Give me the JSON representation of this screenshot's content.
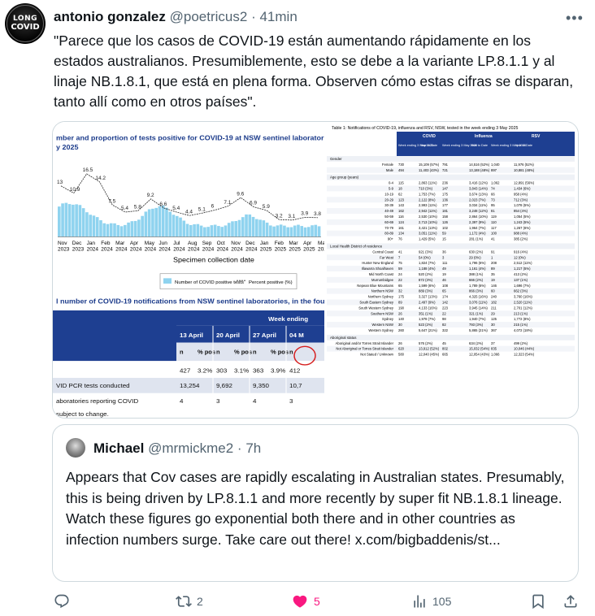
{
  "post": {
    "author_name": "antonio gonzalez",
    "author_handle": "@poetricus2",
    "separator": "·",
    "time": "41min",
    "avatar_text_1": "LONG",
    "avatar_text_2": "COVID",
    "text": "\"Parece que los casos de COVID-19 están aumentando rápidamente en los estados australianos. Presumiblemente, esto se debe a la variante LP.8.1.1 y al linaje NB.1.8.1, que está en plena forma. Observen cómo estas cifras se disparan, tanto allí como en otros países\"."
  },
  "media": {
    "left": {
      "chart_title": "mber and proportion of tests positive for COVID-19 at NSW sentinel laboratories by week,",
      "chart_title_2": "y 2025",
      "x_axis_label": "Specimen collection date",
      "legend_bar": "Number of COVID positive tests",
      "legend_line": "Percent positive (%)",
      "x_ticks_month": [
        "Nov",
        "Dec",
        "Jan",
        "Feb",
        "Mar",
        "Apr",
        "May",
        "Jun",
        "Jul",
        "Aug",
        "Sep",
        "Oct",
        "Nov",
        "Dec",
        "Jan",
        "Feb",
        "Mar",
        "Apr",
        "May"
      ],
      "x_ticks_year": [
        "2023",
        "2023",
        "2024",
        "2024",
        "2024",
        "2024",
        "2024",
        "2024",
        "2024",
        "2024",
        "2024",
        "2024",
        "2024",
        "2024",
        "2025",
        "2025",
        "2025",
        "2025",
        "2025"
      ],
      "pct_labels": [
        "13",
        "10.9",
        "16.5",
        "14.2",
        "7.5",
        "5.4",
        "5.8",
        "9.2",
        "6.6",
        "5.4",
        "4.4",
        "5.1",
        "6",
        "7.1",
        "9.6",
        "6.9",
        "5.9",
        "3.2",
        "3.1",
        "3.9",
        "3.8"
      ],
      "table_title": "l number of COVID-19 notifications from NSW sentinel laboratories, in the four weeks to 4 M",
      "week_ending": "Week ending",
      "weeks": [
        "13 April",
        "20 April",
        "27 April",
        "04 M"
      ],
      "sub_n": "n",
      "sub_pos": "% pos",
      "row1": [
        "427",
        "3.2%",
        "303",
        "3.1%",
        "363",
        "3.9%",
        "412"
      ],
      "row2_label": "VID PCR tests conducted",
      "row2": [
        "13,254",
        "9,692",
        "9,350",
        "10,7"
      ],
      "row3_label": "aboratories reporting COVID",
      "row3": [
        "4",
        "3",
        "4",
        "3"
      ],
      "footnote": "subject to change."
    },
    "right": {
      "title": "Table 1: Notifications of COVID-19, influenza and RSV, NSW, tested in the week ending 3 May 2025",
      "col_covid": "COVID",
      "col_flu": "Influenza",
      "col_rsv": "RSV",
      "sub_week": "Week ending 3 May 2025",
      "sub_ytd": "Year to Date",
      "sections": [
        {
          "heading": "Gender",
          "rows": [
            [
              "Female",
              "730",
              "15,109 (57%)",
              "791",
              "14,516 (52%)",
              "1,040",
              "11,976 (52%)"
            ],
            [
              "Male",
              "494",
              "11,403 (43%)",
              "721",
              "13,188 (48%)",
              "897",
              "10,881 (48%)"
            ]
          ]
        },
        {
          "heading": "Age group (years)",
          "rows": [
            [
              "0-4",
              "115",
              "2,863 (11%)",
              "236",
              "3,416 (12%)",
              "1,062",
              "12,891 (56%)"
            ],
            [
              "5-9",
              "18",
              "710 (3%)",
              "147",
              "3,843 (14%)",
              "74",
              "1,434 (6%)"
            ],
            [
              "10-19",
              "62",
              "1,753 (7%)",
              "175",
              "3,674 (13%)",
              "66",
              "958 (4%)"
            ],
            [
              "20-29",
              "123",
              "2,122 (8%)",
              "136",
              "2,023 (7%)",
              "73",
              "712 (3%)"
            ],
            [
              "30-39",
              "143",
              "2,993 (11%)",
              "177",
              "3,034 (11%)",
              "95",
              "1,078 (5%)"
            ],
            [
              "40-49",
              "162",
              "2,942 (11%)",
              "181",
              "3,248 (12%)",
              "81",
              "854 (4%)"
            ],
            [
              "50-59",
              "116",
              "2,530 (10%)",
              "158",
              "2,864 (10%)",
              "119",
              "1,054 (5%)"
            ],
            [
              "60-69",
              "124",
              "2,713 (10%)",
              "126",
              "2,397 (9%)",
              "110",
              "1,243 (5%)"
            ],
            [
              "70-79",
              "161",
              "3,421 (13%)",
              "102",
              "1,964 (7%)",
              "117",
              "1,267 (6%)"
            ],
            [
              "80-89",
              "134",
              "3,051 (11%)",
              "59",
              "1,172 (4%)",
              "100",
              "988 (4%)"
            ],
            [
              "90+",
              "76",
              "1,429 (5%)",
              "15",
              "281 (1%)",
              "41",
              "385 (2%)"
            ]
          ]
        },
        {
          "heading": "Local Health District of residence",
          "rows": [
            [
              "Central Coast",
              "41",
              "921 (3%)",
              "36",
              "630 (2%)",
              "91",
              "916 (4%)"
            ],
            [
              "Far West",
              "7",
              "54 (0%)",
              "3",
              "29 (0%)",
              "1",
              "12 (0%)"
            ],
            [
              "Hunter New England",
              "75",
              "1,824 (7%)",
              "111",
              "1,796 (6%)",
              "208",
              "2,512 (11%)"
            ],
            [
              "Illawarra Shoalhaven",
              "59",
              "1,188 (4%)",
              "49",
              "1,161 (4%)",
              "89",
              "1,217 (5%)"
            ],
            [
              "Mid North Coast",
              "24",
              "520 (2%)",
              "19",
              "388 (1%)",
              "35",
              "413 (2%)"
            ],
            [
              "Murrumbidgee",
              "22",
              "872 (3%)",
              "46",
              "666 (2%)",
              "19",
              "137 (1%)"
            ],
            [
              "Nepean Blue Mountains",
              "65",
              "1,599 (6%)",
              "108",
              "1,789 (6%)",
              "146",
              "1,696 (7%)"
            ],
            [
              "Northern NSW",
              "32",
              "889 (3%)",
              "65",
              "866 (3%)",
              "60",
              "662 (3%)"
            ],
            [
              "Northern Sydney",
              "175",
              "3,327 (13%)",
              "174",
              "4,325 (16%)",
              "240",
              "3,760 (16%)"
            ],
            [
              "South Eastern Sydney",
              "89",
              "2,497 (9%)",
              "142",
              "3,076 (11%)",
              "182",
              "2,520 (11%)"
            ],
            [
              "South Western Sydney",
              "190",
              "4,133 (16%)",
              "223",
              "3,945 (14%)",
              "211",
              "2,701 (12%)"
            ],
            [
              "Southern NSW",
              "26",
              "351 (1%)",
              "22",
              "321 (1%)",
              "29",
              "213 (1%)"
            ],
            [
              "Sydney",
              "140",
              "1,978 (7%)",
              "98",
              "1,940 (7%)",
              "125",
              "1,772 (8%)"
            ],
            [
              "Western NSW",
              "30",
              "523 (2%)",
              "82",
              "793 (3%)",
              "30",
              "215 (1%)"
            ],
            [
              "Western Sydney",
              "260",
              "5,647 (21%)",
              "322",
              "5,865 (21%)",
              "367",
              "4,072 (18%)"
            ]
          ]
        },
        {
          "heading": "Aboriginal status",
          "rows": [
            [
              "Aboriginal and/or Torres Strait Islander",
              "26",
              "576 (2%)",
              "45",
              "634 (2%)",
              "37",
              "499 (2%)"
            ],
            [
              "Not Aboriginal or Torres Strait Islander",
              "620",
              "13,912 (52%)",
              "802",
              "15,032 (54%)",
              "835",
              "10,046 (44%)"
            ],
            [
              "Not Stated / Unknown",
              "580",
              "12,040 (45%)",
              "665",
              "12,054 (43%)",
              "1,066",
              "12,323 (54%)"
            ]
          ]
        }
      ]
    }
  },
  "quote": {
    "author_name": "Michael",
    "author_handle": "@mrmickme2",
    "separator": "·",
    "time": "7h",
    "text": "Appears that Cov cases are rapidly escalating in Australian states. Presumably, this is being driven by LP.8.1.1 and more recently by super fit NB.1.8.1 lineage. Watch these figures go exponential both there and in other countries as infection numbers surge. Take care out there! x.com/bigbaddenis/st..."
  },
  "actions": {
    "reply_count": "",
    "repost_count": "2",
    "like_count": "5",
    "views_count": "105",
    "like_color": "#f91880",
    "icon_color": "#536471"
  }
}
